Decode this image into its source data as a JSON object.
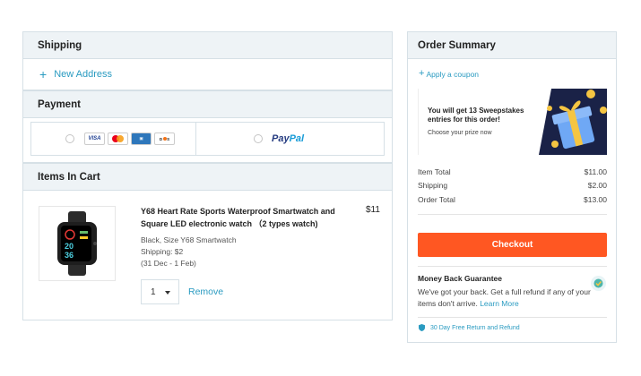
{
  "shipping": {
    "title": "Shipping",
    "new_address_label": "New Address"
  },
  "payment": {
    "title": "Payment",
    "card_logos": [
      "VISA",
      "mastercard",
      "AMEX",
      "DISCOVER"
    ],
    "paypal_label_1": "Pay",
    "paypal_label_2": "Pal"
  },
  "cart": {
    "title": "Items In Cart",
    "item": {
      "title": "Y68 Heart Rate Sports Waterproof Smartwatch and Square LED electronic watch （2 types watch)",
      "price": "$11",
      "variant": "Black, Size Y68 Smartwatch",
      "shipping": "Shipping: $2",
      "delivery": "(31 Dec - 1 Feb)",
      "quantity": "1",
      "remove_label": "Remove"
    }
  },
  "summary": {
    "title": "Order Summary",
    "coupon_label": "Apply a coupon",
    "promo_text": "You will get 13 Sweepstakes entries for this order!",
    "promo_sub": "Choose your prize now",
    "rows": [
      {
        "label": "Item Total",
        "value": "$11.00"
      },
      {
        "label": "Shipping",
        "value": "$2.00"
      },
      {
        "label": "Order Total",
        "value": "$13.00"
      }
    ],
    "checkout_label": "Checkout",
    "mbg_title": "Money Back Guarantee",
    "mbg_text": "We've got your back. Get a full refund if any of your items don't arrive.",
    "mbg_link": "Learn More",
    "guarantee_label": "30 Day Free Return and Refund"
  },
  "colors": {
    "accent": "#2a9bc1",
    "checkout": "#ff5722",
    "panel_header": "#eef3f6"
  }
}
